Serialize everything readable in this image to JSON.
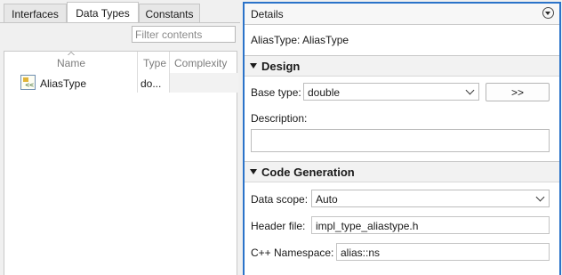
{
  "tabs": [
    {
      "label": "Interfaces",
      "active": false
    },
    {
      "label": "Data Types",
      "active": true
    },
    {
      "label": "Constants",
      "active": false
    }
  ],
  "filter": {
    "placeholder": "Filter contents"
  },
  "list": {
    "columns": [
      "Name",
      "Type",
      "Complexity"
    ],
    "rows": [
      {
        "icon": "alias-type-icon",
        "name": "AliasType",
        "type": "do..."
      }
    ]
  },
  "details": {
    "title": "Details",
    "subtitle": "AliasType: AliasType",
    "design": {
      "heading": "Design",
      "base_type_label": "Base type:",
      "base_type_value": "double",
      "assistant_button": ">>",
      "description_label": "Description:",
      "description_value": ""
    },
    "code_generation": {
      "heading": "Code Generation",
      "data_scope_label": "Data scope:",
      "data_scope_value": "Auto",
      "header_file_label": "Header file:",
      "header_file_value": "impl_type_aliastype.h",
      "namespace_label": "C++ Namespace:",
      "namespace_value": "alias::ns"
    }
  },
  "colors": {
    "focus_border": "#2b73c9",
    "panel_background": "#f0f0f0",
    "section_background": "#f2f2f2"
  }
}
